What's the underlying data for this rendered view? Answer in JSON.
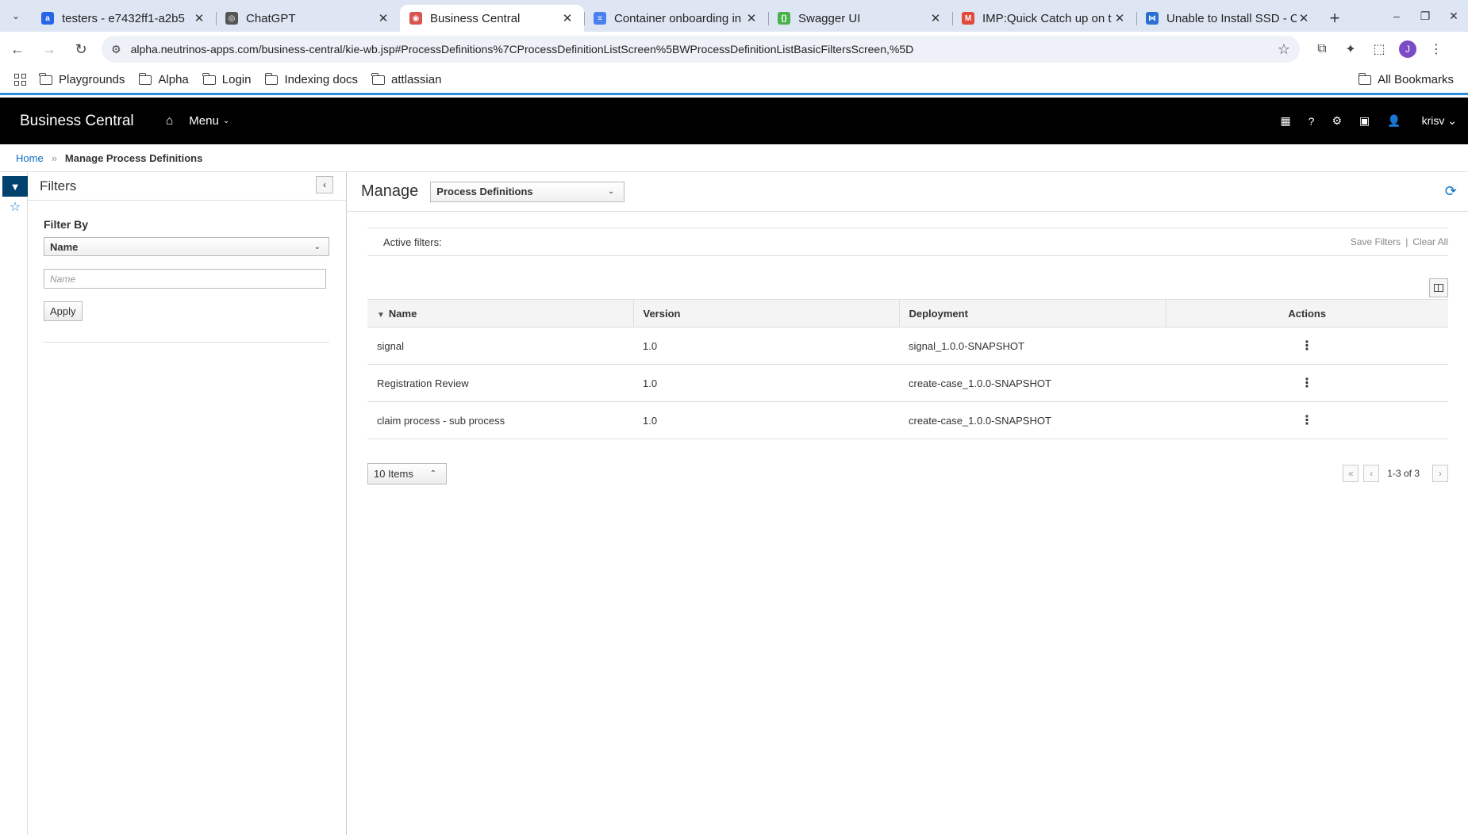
{
  "browser": {
    "tabs": [
      {
        "title": "testers - e7432ff1-a2b5",
        "favicon_color": "#2866e8",
        "favicon_char": "a",
        "active": false
      },
      {
        "title": "ChatGPT",
        "favicon_color": "#555555",
        "favicon_char": "◎",
        "active": false
      },
      {
        "title": "Business Central",
        "favicon_color": "#d9534f",
        "favicon_char": "◉",
        "active": true
      },
      {
        "title": "Container onboarding in",
        "favicon_color": "#4a80f0",
        "favicon_char": "≡",
        "active": false
      },
      {
        "title": "Swagger UI",
        "favicon_color": "#49b04b",
        "favicon_char": "{}",
        "active": false
      },
      {
        "title": "IMP:Quick Catch up on t",
        "favicon_color": "#e04b3a",
        "favicon_char": "M",
        "active": false
      },
      {
        "title": "Unable to Install SSD - C",
        "favicon_color": "#2a6fd1",
        "favicon_char": "⋈",
        "active": false
      }
    ],
    "url": "alpha.neutrinos-apps.com/business-central/kie-wb.jsp#ProcessDefinitions%7CProcessDefinitionListScreen%5BWProcessDefinitionListBasicFiltersScreen,%5D",
    "profile_initial": "J",
    "bookmarks": [
      "Playgrounds",
      "Alpha",
      "Login",
      "Indexing docs",
      "attlassian"
    ],
    "all_bookmarks": "All Bookmarks"
  },
  "app": {
    "brand": "Business Central",
    "menu_label": "Menu",
    "user": "krisv"
  },
  "breadcrumb": {
    "home": "Home",
    "current": "Manage Process Definitions"
  },
  "filters": {
    "title": "Filters",
    "filter_by_label": "Filter By",
    "filter_by_value": "Name",
    "input_placeholder": "Name",
    "apply_label": "Apply"
  },
  "main": {
    "manage_label": "Manage",
    "view_select": "Process Definitions",
    "active_filters_label": "Active filters:",
    "save_filters": "Save Filters",
    "clear_all": "Clear All",
    "columns": [
      "Name",
      "Version",
      "Deployment",
      "Actions"
    ],
    "rows": [
      {
        "name": "signal",
        "version": "1.0",
        "deployment": "signal_1.0.0-SNAPSHOT"
      },
      {
        "name": "Registration Review",
        "version": "1.0",
        "deployment": "create-case_1.0.0-SNAPSHOT"
      },
      {
        "name": "claim process - sub process",
        "version": "1.0",
        "deployment": "create-case_1.0.0-SNAPSHOT"
      }
    ],
    "page_size": "10 Items",
    "pager_info": "1-3 of 3"
  }
}
